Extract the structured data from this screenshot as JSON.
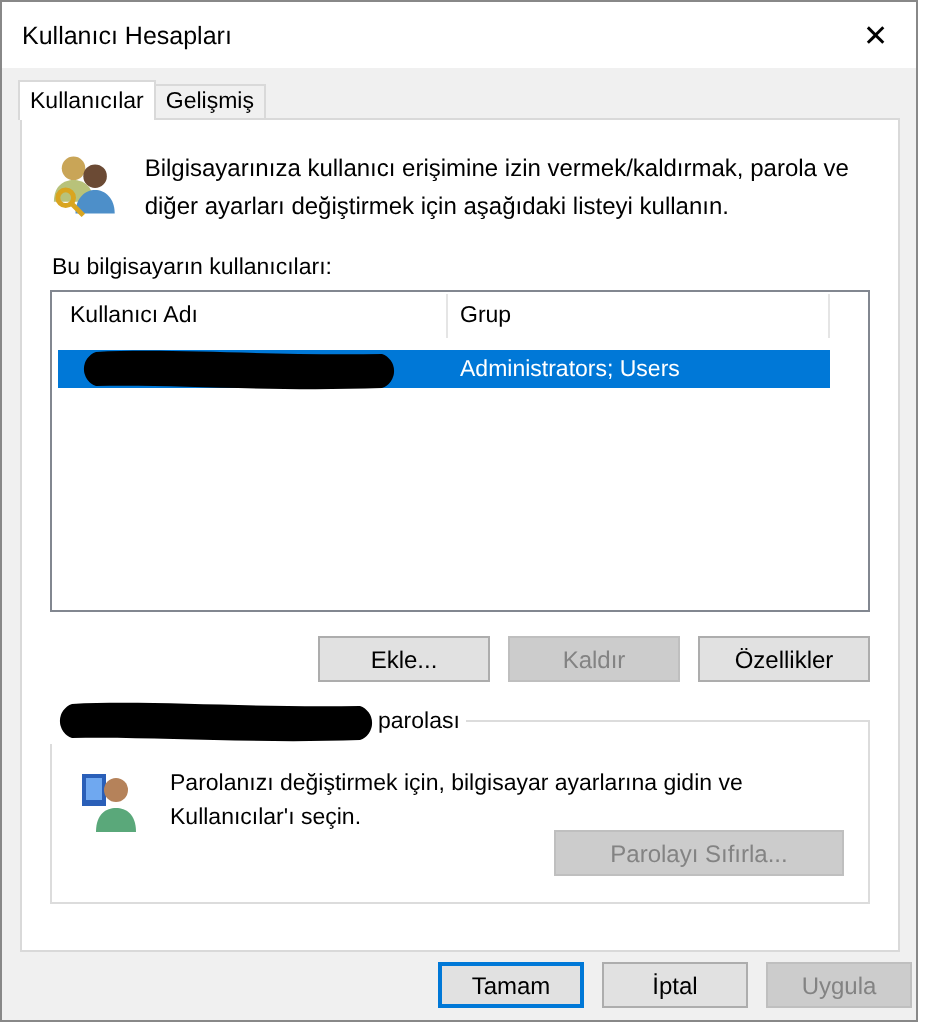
{
  "window": {
    "title": "Kullanıcı Hesapları",
    "close": "✕"
  },
  "tabs": [
    {
      "label": "Kullanıcılar",
      "selected": true
    },
    {
      "label": "Gelişmiş",
      "selected": false
    }
  ],
  "intro": "Bilgisayarınıza kullanıcı erişimine izin vermek/kaldırmak, parola ve diğer ayarları değiştirmek için aşağıdaki listeyi kullanın.",
  "users_label": "Bu bilgisayarın kullanıcıları:",
  "table": {
    "columns": [
      "Kullanıcı Adı",
      "Grup"
    ],
    "rows": [
      {
        "name_redacted": true,
        "group": "Administrators; Users",
        "selected": true
      }
    ]
  },
  "list_buttons": [
    {
      "label": "Ekle...",
      "disabled": false
    },
    {
      "label": "Kaldır",
      "disabled": true
    },
    {
      "label": "Özellikler",
      "disabled": false
    }
  ],
  "password_group": {
    "title_redacted": true,
    "title": "parolası",
    "text": "Parolanızı değiştirmek için, bilgisayar ayarlarına gidin ve Kullanıcılar'ı seçin.",
    "button": {
      "label": "Parolayı Sıfırla...",
      "disabled": true
    }
  },
  "footer_buttons": [
    {
      "label": "Tamam",
      "disabled": false,
      "default": true
    },
    {
      "label": "İptal",
      "disabled": false,
      "default": false
    },
    {
      "label": "Uygula",
      "disabled": true,
      "default": false
    }
  ]
}
